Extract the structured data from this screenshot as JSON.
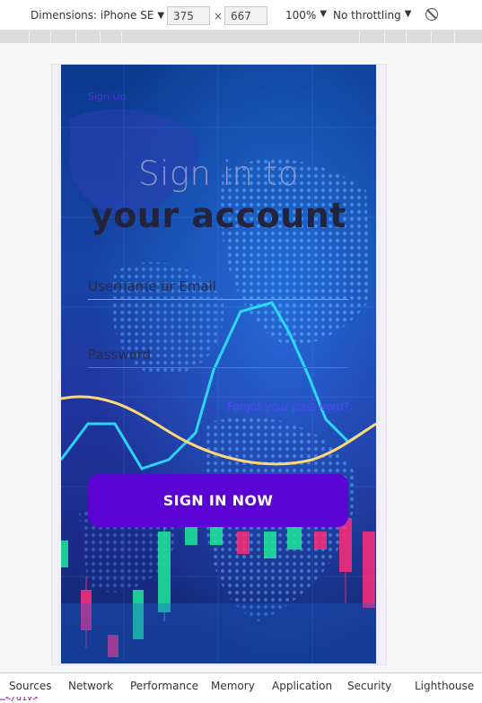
{
  "toolbar": {
    "dimensions_label": "Dimensions: iPhone SE",
    "width_value": "375",
    "height_value": "667",
    "times": "×",
    "zoom_label": "100%",
    "throttle_label": "No throttling",
    "caret": "▼"
  },
  "app": {
    "signup_link": "Sign Up",
    "title_line1": "Sign in to",
    "title_line2": "your account",
    "username_placeholder": "Username or Email",
    "password_placeholder": "Password",
    "forgot_link": "Forgot your password?",
    "signin_button": "SIGN IN NOW"
  },
  "devtools": {
    "tabs": [
      "Sources",
      "Network",
      "Performance",
      "Memory",
      "Application",
      "Security",
      "Lighthouse"
    ],
    "dom_snippet": "…</div>"
  },
  "colors": {
    "accent": "#5a03d4",
    "username_underline": "#34c9d9",
    "password_underline": "#d84560",
    "link": "#4a4bf0"
  }
}
